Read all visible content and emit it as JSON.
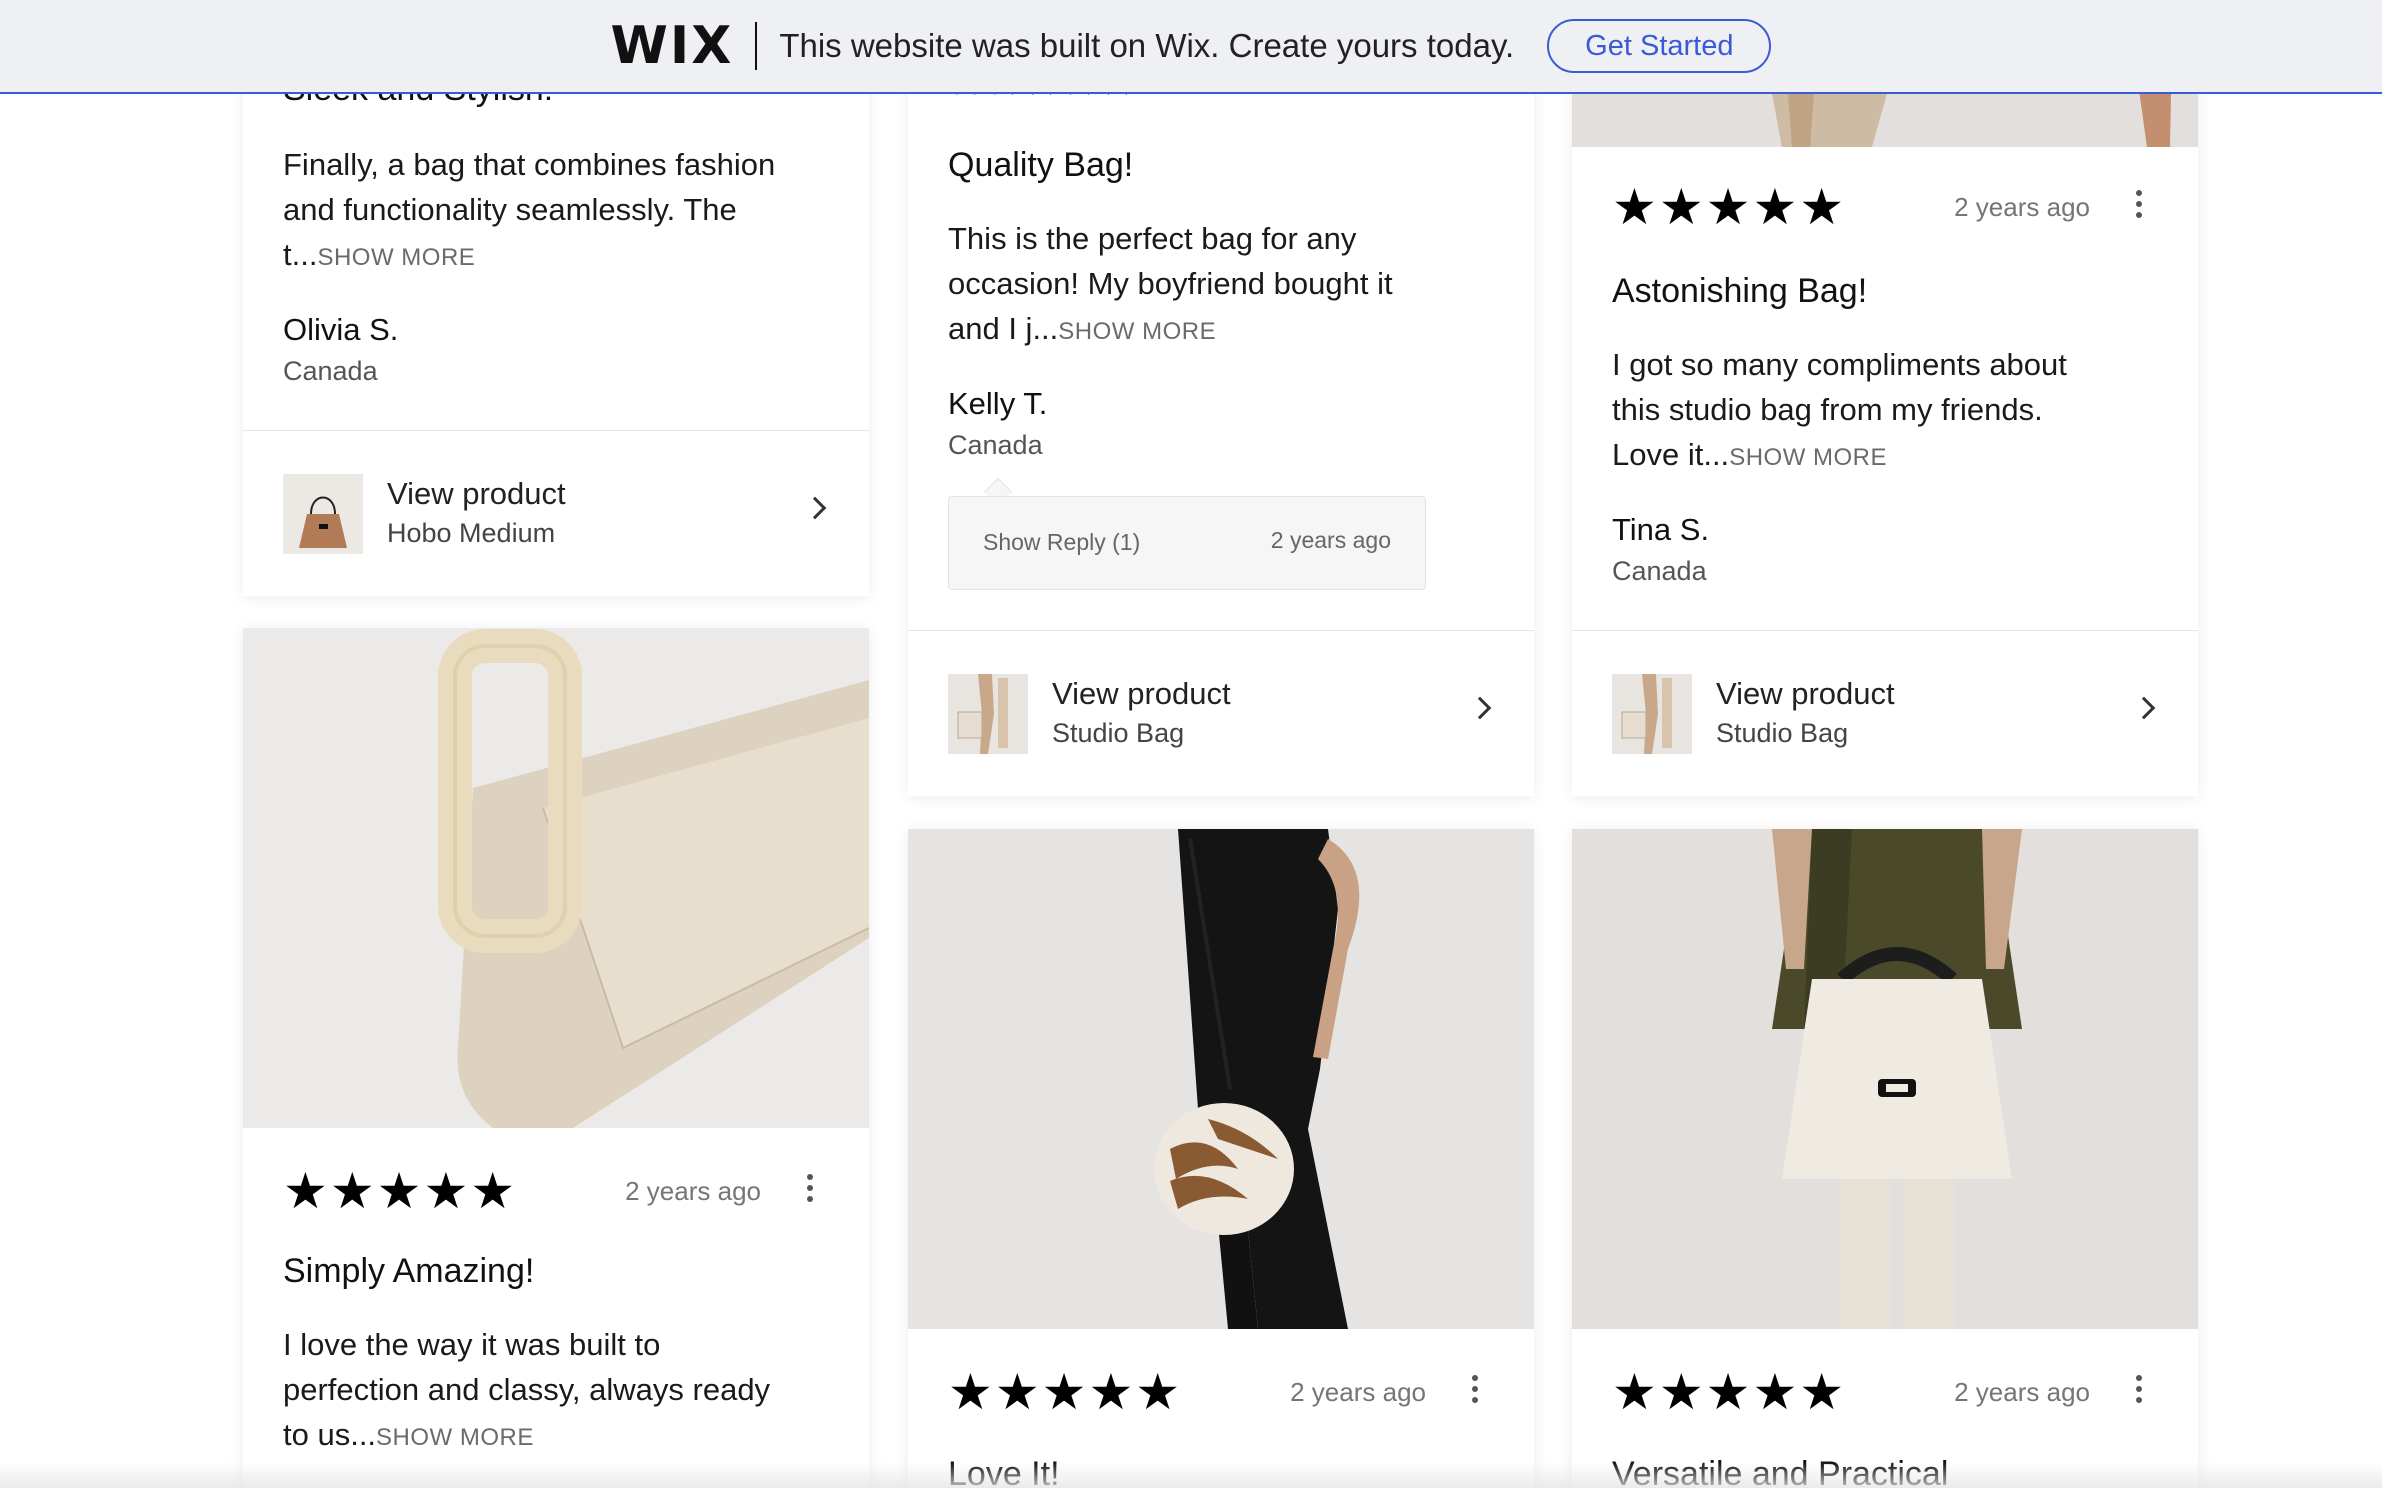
{
  "banner": {
    "logo": "WIX",
    "text": "This website was built on Wix. Create yours today.",
    "cta": "Get Started"
  },
  "cards": {
    "c1": {
      "title_partial": "Sleek and Stylish!",
      "text": "Finally, a bag that combines fashion and functionality seamlessly. The t...",
      "show_more": "SHOW MORE",
      "author": "Olivia S.",
      "country": "Canada",
      "view_product": "View product",
      "product": "Hobo Medium"
    },
    "c2": {
      "title": "Quality Bag!",
      "text": "This is the perfect bag for any occasion! My boyfriend bought it and I j...",
      "show_more": "SHOW MORE",
      "author": "Kelly T.",
      "country": "Canada",
      "reply_label": "Show Reply (1)",
      "reply_age": "2 years ago",
      "view_product": "View product",
      "product": "Studio Bag"
    },
    "c3": {
      "stars": "★★★★★",
      "age": "2 years ago",
      "title": "Astonishing Bag!",
      "text": "I got so many compliments about this studio bag from my friends. Love it...",
      "show_more": "SHOW MORE",
      "author": "Tina S.",
      "country": "Canada",
      "view_product": "View product",
      "product": "Studio Bag"
    },
    "c4": {
      "stars": "★★★★★",
      "age": "2 years ago",
      "title": "Simply Amazing!",
      "text": "I love the way it was built to perfection and classy, always ready to us...",
      "show_more": "SHOW MORE"
    },
    "c5": {
      "stars": "★★★★★",
      "age": "2 years ago",
      "title": "Love It!"
    },
    "c6": {
      "stars": "★★★★★",
      "age": "2 years ago",
      "title": "Versatile and Practical"
    }
  }
}
